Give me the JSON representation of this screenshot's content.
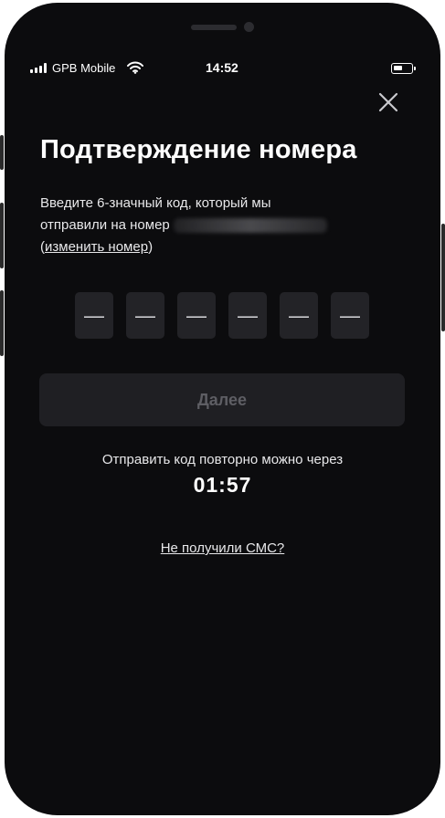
{
  "status_bar": {
    "carrier": "GPB Mobile",
    "time": "14:52"
  },
  "header": {
    "title": "Подтверждение номера"
  },
  "instructions": {
    "line1": "Введите 6-значный код, который мы",
    "line2_prefix": "отправили на номер",
    "open_paren": "(",
    "change_link": "изменить номер",
    "close_paren": ")"
  },
  "code_input": {
    "placeholders": [
      "—",
      "—",
      "—",
      "—",
      "—",
      "—"
    ]
  },
  "next_button": {
    "label": "Далее",
    "state": "disabled"
  },
  "resend": {
    "text": "Отправить код повторно можно через",
    "countdown": "01:57"
  },
  "no_sms_link": {
    "label": "Не получили СМС?"
  },
  "icons": {
    "close": "close-icon",
    "signal": "cellular-signal-icon",
    "wifi": "wifi-icon",
    "battery": "battery-icon"
  },
  "colors": {
    "screen_background": "#0c0c0e",
    "code_cell_background": "#232327",
    "button_disabled_background": "#1f1f23",
    "button_disabled_text": "#5e5e64",
    "text_primary": "#ffffff",
    "text_secondary": "#e8e8ea"
  }
}
